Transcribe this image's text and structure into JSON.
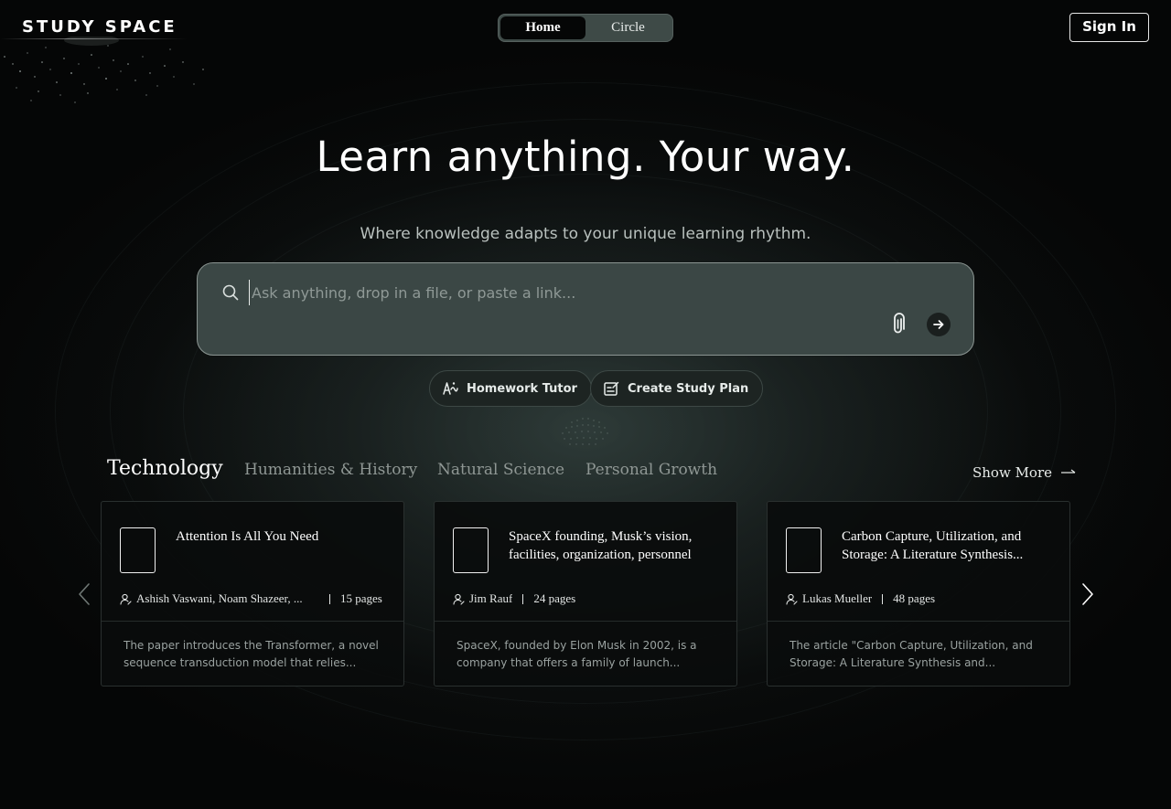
{
  "header": {
    "logo": "STUDY SPACE",
    "nav": [
      {
        "label": "Home",
        "active": true
      },
      {
        "label": "Circle",
        "active": false
      }
    ],
    "sign_in": "Sign In"
  },
  "hero": {
    "title": "Learn anything. Your way.",
    "subtitle": "Where knowledge adapts to your unique learning rhythm."
  },
  "search": {
    "placeholder": "Ask anything, drop in a file, or paste a link...",
    "value": "",
    "icons": {
      "search": "search-icon",
      "attach": "paperclip-icon",
      "submit": "arrow-right-icon"
    }
  },
  "actions": [
    {
      "label": "Homework Tutor",
      "icon": "tutor-icon"
    },
    {
      "label": "Create Study Plan",
      "icon": "study-plan-icon"
    }
  ],
  "categories": {
    "tabs": [
      {
        "label": "Technology",
        "active": true
      },
      {
        "label": "Humanities & History",
        "active": false
      },
      {
        "label": "Natural Science",
        "active": false
      },
      {
        "label": "Personal Growth",
        "active": false
      }
    ],
    "show_more": "Show More"
  },
  "cards": [
    {
      "title": "Attention Is All You Need",
      "author": "Ashish Vaswani, Noam Shazeer, ...",
      "pages": "15 pages",
      "description": "The paper introduces the Transformer, a novel sequence transduction model that relies..."
    },
    {
      "title": "SpaceX founding, Musk’s vision, facilities, organization, personnel",
      "author": "Jim Rauf",
      "pages": "24 pages",
      "description": "SpaceX, founded by Elon Musk in 2002, is a company that offers a family of launch..."
    },
    {
      "title": "Carbon Capture, Utilization, and Storage: A Literature Synthesis...",
      "author": "Lukas Mueller",
      "pages": "48 pages",
      "description": "The article \"Carbon Capture, Utilization, and Storage: A Literature Synthesis and..."
    }
  ],
  "colors": {
    "background": "#050606",
    "search_bg": "#3b4745",
    "toggle_bg": "#3e4a47",
    "card_bg": "#0a0c0c",
    "muted_text": "#8f9794"
  }
}
